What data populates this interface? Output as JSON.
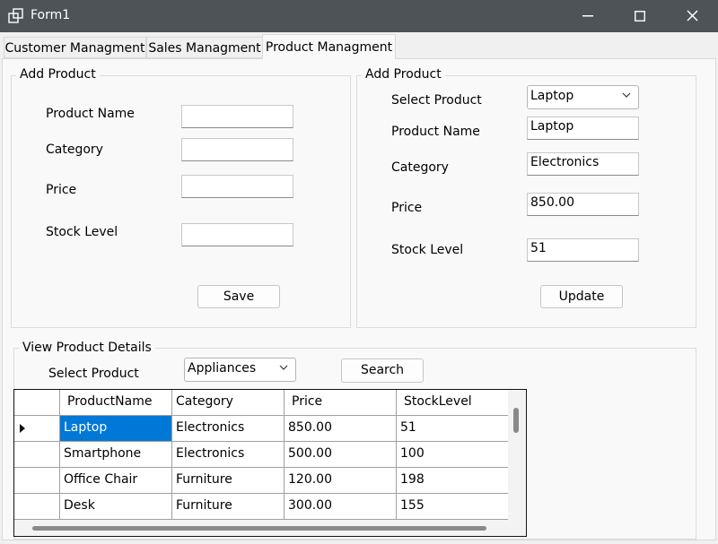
{
  "window": {
    "title": "Form1"
  },
  "tabs": [
    {
      "label": "Customer Managment"
    },
    {
      "label": "Sales Managment"
    },
    {
      "label": "Product Managment"
    }
  ],
  "add_product": {
    "legend": "Add Product",
    "fields": {
      "name_label": "Product Name",
      "category_label": "Category",
      "price_label": "Price",
      "stock_label": "Stock Level"
    },
    "values": {
      "name": "",
      "category": "",
      "price": "",
      "stock": ""
    },
    "save_label": "Save"
  },
  "update_product": {
    "legend": "Add Product",
    "select_label": "Select Product",
    "select_value": "Laptop",
    "name_label": "Product Name",
    "category_label": "Category",
    "price_label": "Price",
    "stock_label": "Stock Level",
    "values": {
      "name": "Laptop",
      "category": "Electronics",
      "price": "850.00",
      "stock": "51"
    },
    "update_label": "Update"
  },
  "view_details": {
    "legend": "View Product Details",
    "select_label": "Select Product",
    "select_value": "Appliances",
    "search_label": "Search"
  },
  "grid": {
    "columns": [
      "ProductName",
      "Category",
      "Price",
      "StockLevel"
    ],
    "rows": [
      [
        "Laptop",
        "Electronics",
        "850.00",
        "51"
      ],
      [
        "Smartphone",
        "Electronics",
        "500.00",
        "100"
      ],
      [
        "Office Chair",
        "Furniture",
        "120.00",
        "198"
      ],
      [
        "Desk",
        "Furniture",
        "300.00",
        "155"
      ]
    ]
  },
  "colors": {
    "titlebar": "#4e5357",
    "selection": "#0078d7",
    "background": "#f0f0f0"
  }
}
